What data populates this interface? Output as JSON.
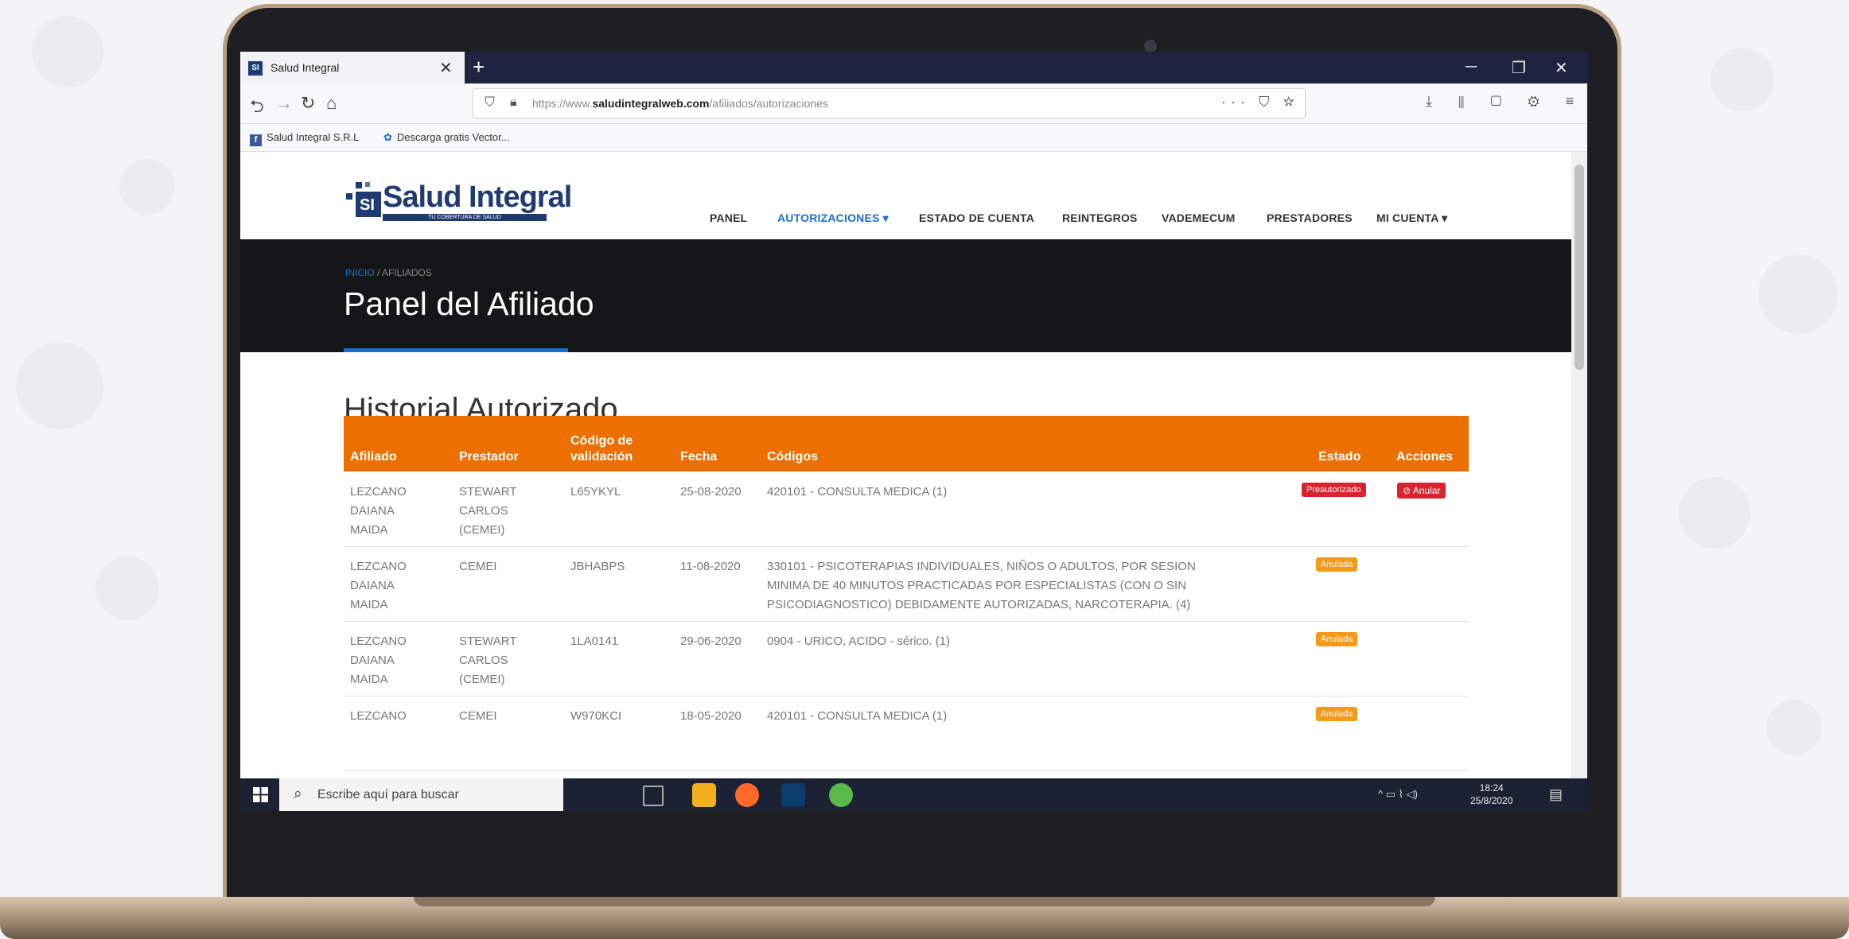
{
  "browser": {
    "tab_title": "Salud Integral",
    "tab_close": "✕",
    "new_tab": "+",
    "url_prefix": "https://www.",
    "url_domain": "saludintegralweb.com",
    "url_path": "/afiliados/autorizaciones",
    "url_actions": "··· ⛉ ☆",
    "bookmarks": [
      "Salud Integral S.R.L",
      "Descarga gratis Vector..."
    ]
  },
  "site": {
    "logo_text": "Salud Integral",
    "logo_tagline": "TU COBERTURA DE SALUD",
    "logo_mark": "SI",
    "menu": [
      "PANEL",
      "AUTORIZACIONES ▾",
      "ESTADO DE CUENTA",
      "REINTEGROS",
      "VADEMECUM",
      "PRESTADORES",
      "MI CUENTA ▾"
    ]
  },
  "hero": {
    "breadcrumb_home": "INICIO",
    "breadcrumb_sep": "/",
    "breadcrumb_current": "AFILIADOS",
    "title": "Panel del Afiliado"
  },
  "history": {
    "title": "Historial Autorizado",
    "headers": {
      "afiliado": "Afiliado",
      "prestador": "Prestador",
      "codigo_validacion_1": "Código de",
      "codigo_validacion_2": "validación",
      "fecha": "Fecha",
      "codigos": "Códigos",
      "estado": "Estado",
      "acciones": "Acciones"
    },
    "rows": [
      {
        "afiliado": [
          "LEZCANO",
          "DAIANA",
          "MAIDA"
        ],
        "prestador": [
          "STEWART",
          "CARLOS",
          "(CEMEI)"
        ],
        "codigo": "L65YKYL",
        "fecha": "25-08-2020",
        "codigos": [
          "420101 - CONSULTA MEDICA (1)"
        ],
        "estado": "Preautorizado",
        "accion": "⊘ Anular"
      },
      {
        "afiliado": [
          "LEZCANO",
          "DAIANA",
          "MAIDA"
        ],
        "prestador": [
          "CEMEI"
        ],
        "codigo": "JBHABPS",
        "fecha": "11-08-2020",
        "codigos": [
          "330101 - PSICOTERAPIAS INDIVIDUALES, NIÑOS O ADULTOS, POR SESION",
          "MINIMA DE 40 MINUTOS PRACTICADAS POR ESPECIALISTAS (CON O SIN",
          "PSICODIAGNOSTICO) DEBIDAMENTE AUTORIZADAS, NARCOTERAPIA. (4)"
        ],
        "estado": "Anulada"
      },
      {
        "afiliado": [
          "LEZCANO",
          "DAIANA",
          "MAIDA"
        ],
        "prestador": [
          "STEWART",
          "CARLOS",
          "(CEMEI)"
        ],
        "codigo": "1LA0141",
        "fecha": "29-06-2020",
        "codigos": [
          "0904 - URICO, ACIDO - sérico. (1)"
        ],
        "estado": "Anulada"
      },
      {
        "afiliado": [
          "LEZCANO"
        ],
        "prestador": [
          "CEMEI"
        ],
        "codigo": "W970KCI",
        "fecha": "18-05-2020",
        "codigos": [
          "420101 - CONSULTA MEDICA (1)"
        ],
        "estado": "Anulada"
      }
    ]
  },
  "taskbar": {
    "search_placeholder": "Escribe aquí para buscar",
    "time": "18:24",
    "date": "25/8/2020",
    "tray": "^ ▭ ⌇ ◁)"
  },
  "colors": {
    "accent_orange": "#ec6f00",
    "accent_blue": "#1a6fd1",
    "brand_navy": "#1f3b72",
    "badge_red": "#d9242f",
    "badge_orange": "#f39a1b"
  }
}
